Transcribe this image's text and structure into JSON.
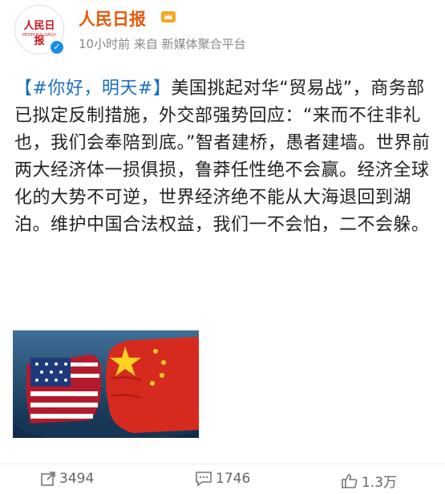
{
  "post": {
    "author": "人民日报",
    "meta": "10小时前 来自 新媒体聚合平台",
    "avatar_logo": "人民日报",
    "avatar_sub": "PEOPLE'S DAILY",
    "topic": "【#你好，明天#】",
    "text": "美国挑起对华“贸易战”，商务部已拟定反制措施，外交部强势回应：“来而不往非礼也，我们会奉陪到底。”智者建桥，愚者建墙。世界前两大经济体一损俱损，鲁莽任性绝不会赢。经济全球化的大势不可逆，世界经济绝不能从大海退回到湖泊。维护中国合法权益，我们一不会怕，二不会躲。"
  },
  "actions": {
    "repost": "3494",
    "comment": "1746",
    "like": "1.3万"
  },
  "colors": {
    "author": "#e8590c",
    "topic": "#1a6fc2",
    "verified": "#1a8ee6"
  }
}
